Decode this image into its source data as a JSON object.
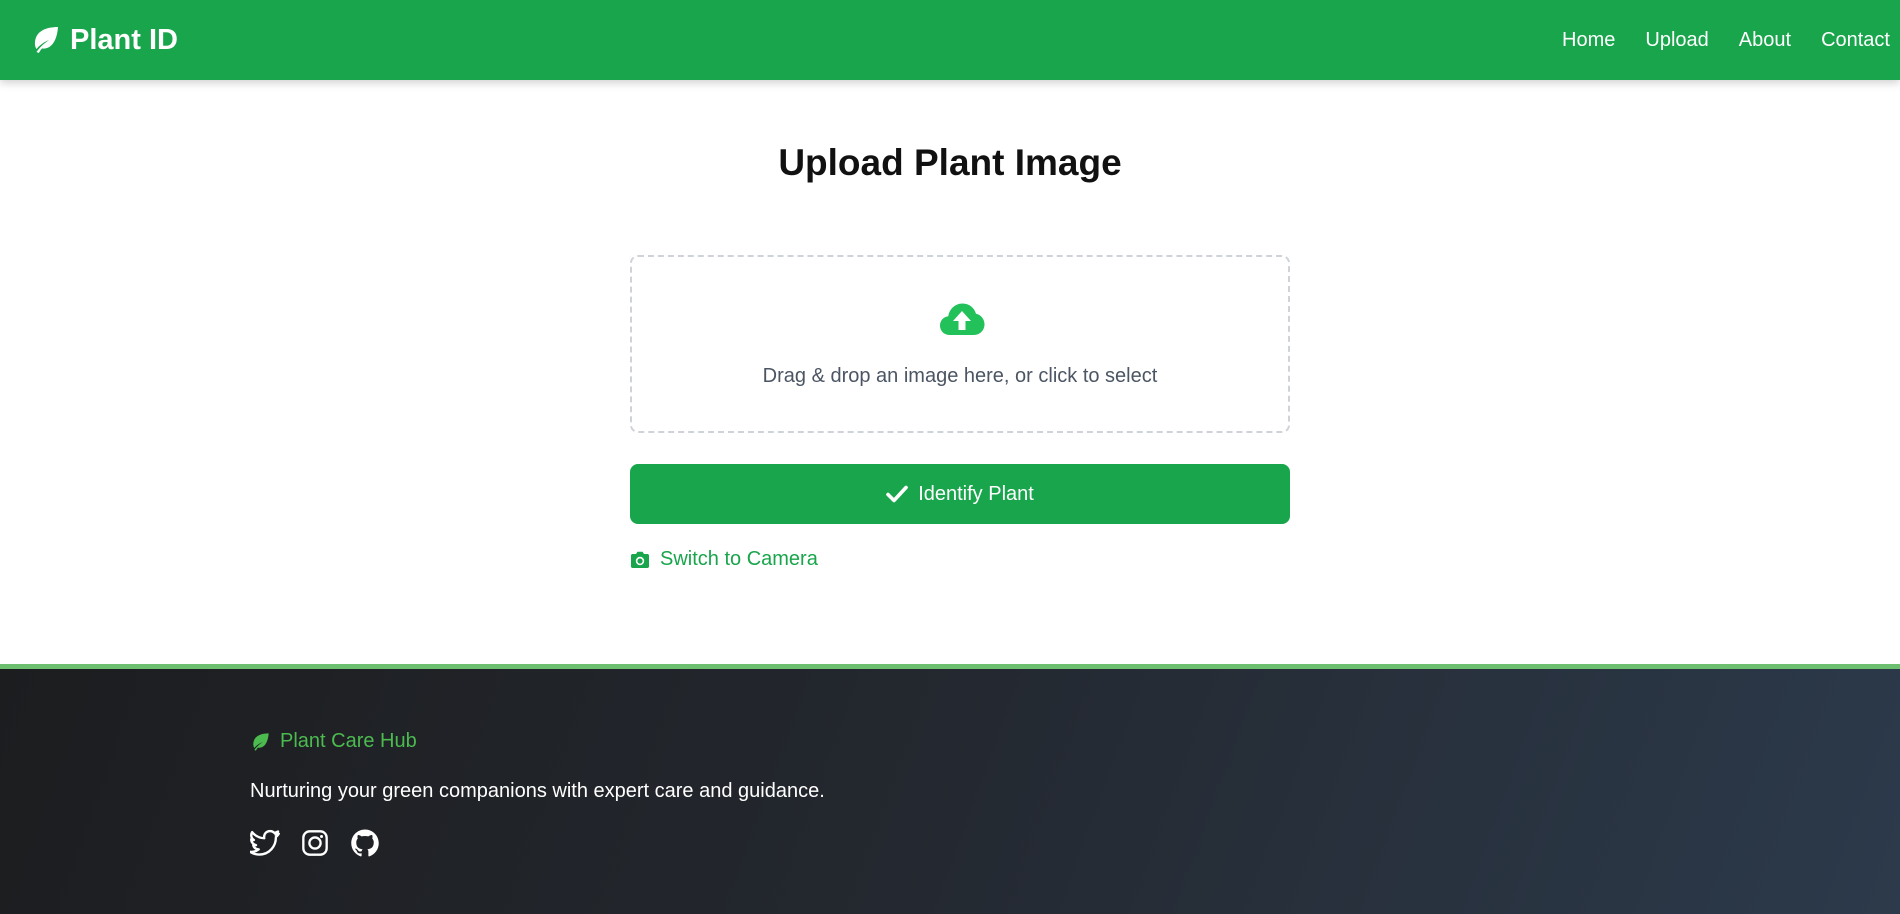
{
  "header": {
    "brand": "Plant ID",
    "nav": [
      {
        "label": "Home"
      },
      {
        "label": "Upload"
      },
      {
        "label": "About"
      },
      {
        "label": "Contact"
      }
    ],
    "color": "#19a54b"
  },
  "main": {
    "title": "Upload Plant Image",
    "dropzone": {
      "icon": "cloud-upload-icon",
      "hint": "Drag & drop an image here, or click to select"
    },
    "identify_button": {
      "icon": "check-icon",
      "label": "Identify Plant"
    },
    "camera_link": {
      "icon": "camera-icon",
      "label": "Switch to Camera"
    }
  },
  "footer": {
    "brand": "Plant Care Hub",
    "tagline": "Nurturing your green companions with expert care and guidance.",
    "socials": [
      {
        "icon": "twitter-icon"
      },
      {
        "icon": "instagram-icon"
      },
      {
        "icon": "github-icon"
      }
    ],
    "accent": "#4cbb4f"
  }
}
